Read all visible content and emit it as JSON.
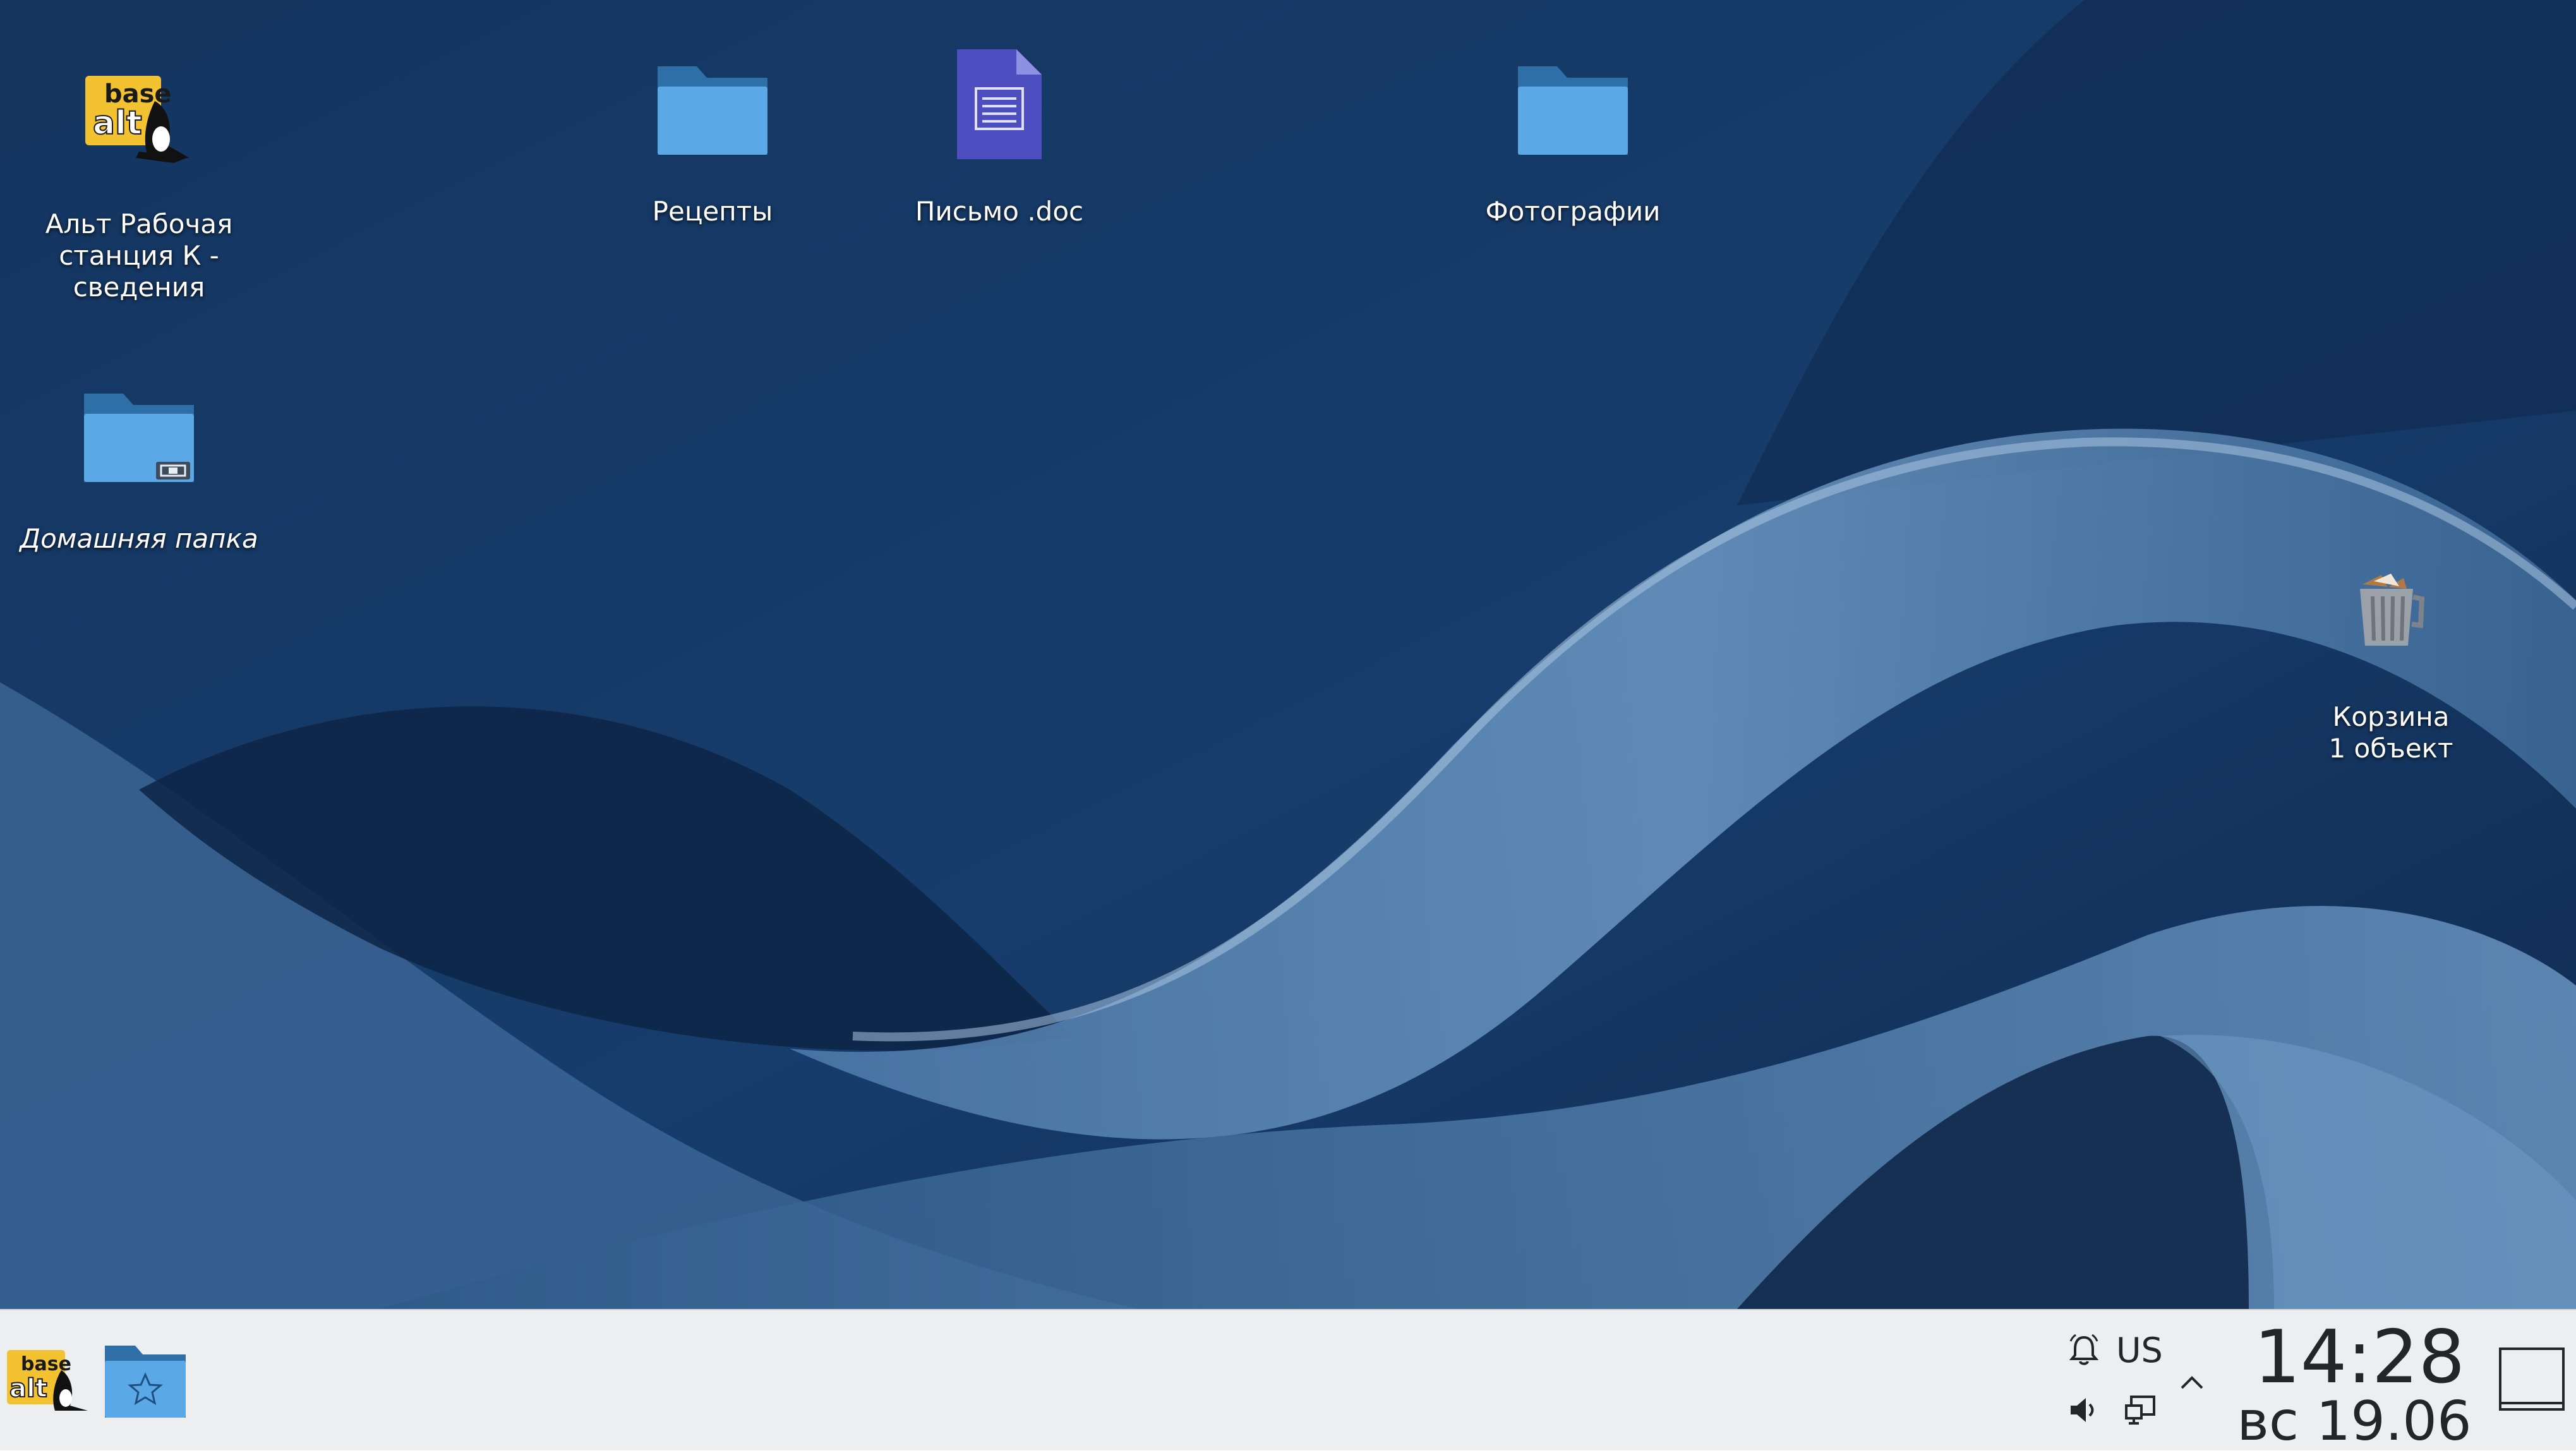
{
  "desktop": {
    "icons": [
      {
        "label": "Альт Рабочая\nстанция К  -\nсведения",
        "icon": "basealt-logo-icon"
      },
      {
        "label": "Рецепты",
        "icon": "folder-icon"
      },
      {
        "label": "Письмо .doc",
        "icon": "document-icon"
      },
      {
        "label": "Фотографии",
        "icon": "folder-icon"
      },
      {
        "label": "Домашняя папка",
        "icon": "home-folder-icon"
      },
      {
        "label": "Корзина\n1 объект",
        "icon": "trash-icon"
      }
    ],
    "logo_text_top": "base",
    "logo_text_bottom": "alt"
  },
  "panel": {
    "launcher_icon": "basealt-logo-icon",
    "task_icon": "favorites-folder-icon",
    "tray": {
      "notifications_icon": "bell-icon",
      "keyboard_layout": "US",
      "volume_icon": "speaker-icon",
      "network_icon": "network-icon",
      "expand_icon": "chevron-up-icon"
    },
    "clock": {
      "time": "14:28",
      "date": "вс 19.06"
    },
    "show_desktop_icon": "show-desktop-icon"
  },
  "colors": {
    "wallpaper_base": "#163a66",
    "panel_bg": "#eceef0",
    "folder_blue": "#5aa9e6",
    "document_purple": "#4d4fc1",
    "logo_yellow": "#f2c230"
  }
}
